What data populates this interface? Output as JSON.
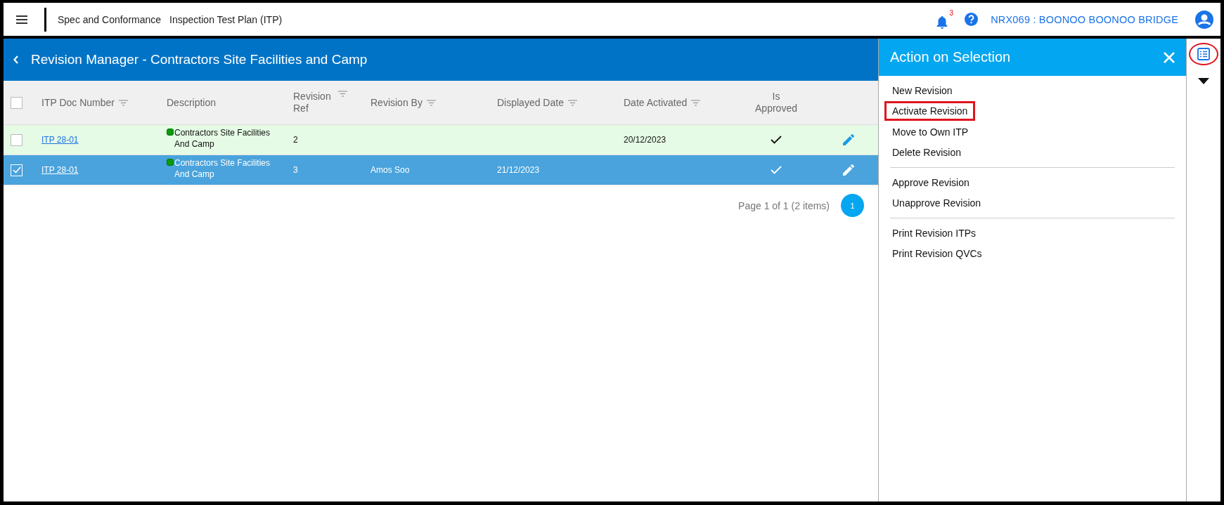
{
  "app_bar": {
    "module": "Spec and Conformance",
    "page": "Inspection Test Plan (ITP)",
    "notification_count": "3",
    "project": "NRX069 : BOONOO BOONOO BRIDGE"
  },
  "title": "Revision Manager - Contractors Site Facilities and Camp",
  "table": {
    "all_checked": false,
    "columns": [
      {
        "label": "ITP Doc Number",
        "filter": true
      },
      {
        "label": "Description",
        "filter": false
      },
      {
        "label": "Revision Ref",
        "filter": true
      },
      {
        "label": "Revision By",
        "filter": true
      },
      {
        "label": "Displayed Date",
        "filter": true
      },
      {
        "label": "Date Activated",
        "filter": true
      },
      {
        "label": "Is Approved",
        "filter": false
      }
    ],
    "rows": [
      {
        "selected": false,
        "active": true,
        "doc_number": "ITP 28-01",
        "color": "#0a9a0a",
        "description": "Contractors Site Facilities And Camp",
        "revision_ref": "2",
        "revision_by": "",
        "displayed_date": "",
        "date_activated": "20/12/2023",
        "approved": true
      },
      {
        "selected": true,
        "active": false,
        "doc_number": "ITP 28-01",
        "color": "#0a9a0a",
        "description": "Contractors Site Facilities And Camp",
        "revision_ref": "3",
        "revision_by": "Amos Soo",
        "displayed_date": "21/12/2023",
        "date_activated": "",
        "approved": true
      }
    ],
    "pager": {
      "summary": "Page 1 of 1 (2 items)",
      "pages": [
        {
          "label": "1",
          "selected": true
        }
      ]
    }
  },
  "action_panel": {
    "title": "Action on Selection",
    "groups": [
      [
        {
          "label": "New Revision",
          "highlighted": false
        },
        {
          "label": "Activate Revision",
          "highlighted": true
        },
        {
          "label": "Move to Own ITP",
          "highlighted": false
        },
        {
          "label": "Delete Revision",
          "highlighted": false
        }
      ],
      [
        {
          "label": "Approve Revision",
          "highlighted": false
        },
        {
          "label": "Unapprove Revision",
          "highlighted": false
        }
      ],
      [
        {
          "label": "Print Revision ITPs",
          "highlighted": false
        },
        {
          "label": "Print Revision QVCs",
          "highlighted": false
        }
      ]
    ]
  },
  "side_strip": {
    "list_icon_highlighted": true
  }
}
